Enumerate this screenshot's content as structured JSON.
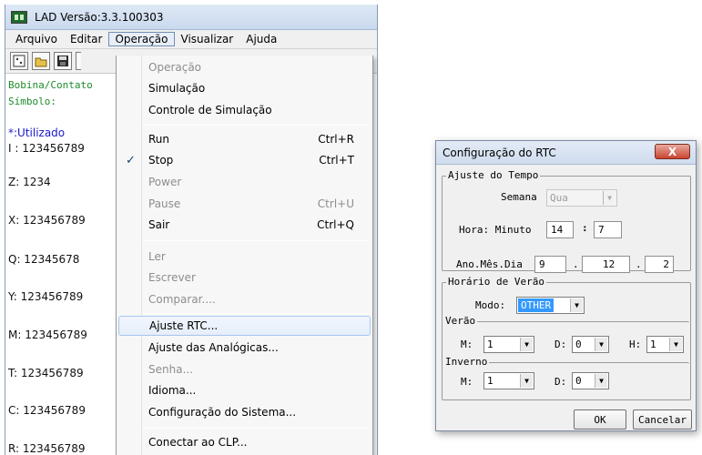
{
  "lad": {
    "title": "LAD Versão:3.3.100303",
    "menu": [
      "Arquivo",
      "Editar",
      "Operação",
      "Visualizar",
      "Ajuda"
    ],
    "left_panel": {
      "line1": "Bobina/Contato",
      "line2": "Símbolo:",
      "used_label": "*:Utilizado",
      "rows": [
        "I : 123456789",
        "Z: 1234",
        "X: 123456789",
        "Q: 12345678",
        "Y: 123456789",
        "M: 123456789",
        "T: 123456789",
        "C: 123456789",
        "R: 123456789"
      ]
    }
  },
  "dropdown": {
    "items": [
      {
        "label": "Operação",
        "shortcut": "",
        "disabled": true
      },
      {
        "label": "Simulação",
        "shortcut": "",
        "disabled": false
      },
      {
        "label": "Controle de Simulação",
        "shortcut": "",
        "disabled": false
      },
      {
        "label": "Run",
        "shortcut": "Ctrl+R",
        "disabled": false
      },
      {
        "label": "Stop",
        "shortcut": "Ctrl+T",
        "disabled": false,
        "checked": true
      },
      {
        "label": "Power",
        "shortcut": "",
        "disabled": true
      },
      {
        "label": "Pause",
        "shortcut": "Ctrl+U",
        "disabled": true
      },
      {
        "label": "Sair",
        "shortcut": "Ctrl+Q",
        "disabled": false
      },
      {
        "label": "Ler",
        "shortcut": "",
        "disabled": true
      },
      {
        "label": "Escrever",
        "shortcut": "",
        "disabled": true
      },
      {
        "label": "Comparar....",
        "shortcut": "",
        "disabled": true
      },
      {
        "label": "Ajuste RTC...",
        "shortcut": "",
        "disabled": false,
        "highlighted": true
      },
      {
        "label": "Ajuste das Analógicas...",
        "shortcut": "",
        "disabled": false
      },
      {
        "label": "Senha...",
        "shortcut": "",
        "disabled": true
      },
      {
        "label": "Idioma...",
        "shortcut": "",
        "disabled": false
      },
      {
        "label": "Configuração do Sistema...",
        "shortcut": "",
        "disabled": false
      },
      {
        "label": "Conectar ao CLP...",
        "shortcut": "",
        "disabled": false
      }
    ]
  },
  "rtc": {
    "title": "Configuração do RTC",
    "close": "X",
    "time_group": "Ajuste do Tempo",
    "semana_label": "Semana",
    "semana_value": "Qua",
    "hora_label": "Hora: Minuto",
    "hora": "14",
    "minuto": "7",
    "time_sep": ":",
    "date_label": "Ano.Mês.Dia",
    "ano": "9",
    "mes": "12",
    "dia": "2",
    "date_sep": ".",
    "dst_group": "Horário de Verão",
    "modo_label": "Modo:",
    "modo_value": "OTHER",
    "verao_group": "Verão",
    "verao_m_label": "M:",
    "verao_m": "1",
    "verao_d_label": "D:",
    "verao_d": "0",
    "verao_h_label": "H:",
    "verao_h": "1",
    "inverno_group": "Inverno",
    "inverno_m_label": "M:",
    "inverno_m": "1",
    "inverno_d_label": "D:",
    "inverno_d": "0",
    "ok": "OK",
    "cancel": "Cancelar"
  }
}
